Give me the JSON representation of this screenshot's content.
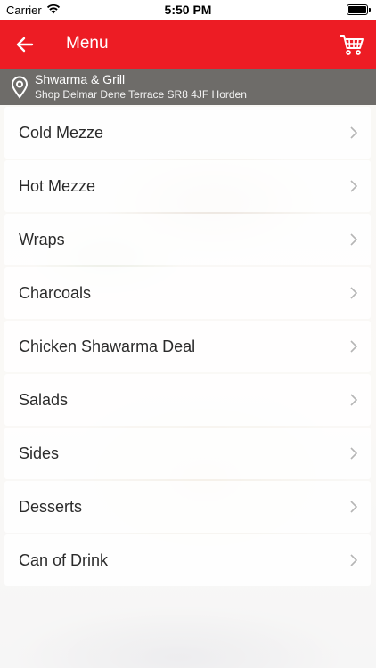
{
  "status_bar": {
    "carrier": "Carrier",
    "time": "5:50 PM"
  },
  "navbar": {
    "title": "Menu",
    "back_icon": "arrow-left-icon",
    "cart_icon": "cart-icon",
    "color": "#ed1c24"
  },
  "location": {
    "name": "Shwarma & Grill",
    "address": "Shop Delmar Dene Terrace SR8 4JF Horden",
    "icon": "location-pin-icon"
  },
  "menu": {
    "items": [
      {
        "label": "Cold Mezze"
      },
      {
        "label": "Hot Mezze"
      },
      {
        "label": "Wraps"
      },
      {
        "label": "Charcoals"
      },
      {
        "label": "Chicken Shawarma Deal"
      },
      {
        "label": "Salads"
      },
      {
        "label": "Sides"
      },
      {
        "label": "Desserts"
      },
      {
        "label": "Can of Drink"
      }
    ]
  }
}
